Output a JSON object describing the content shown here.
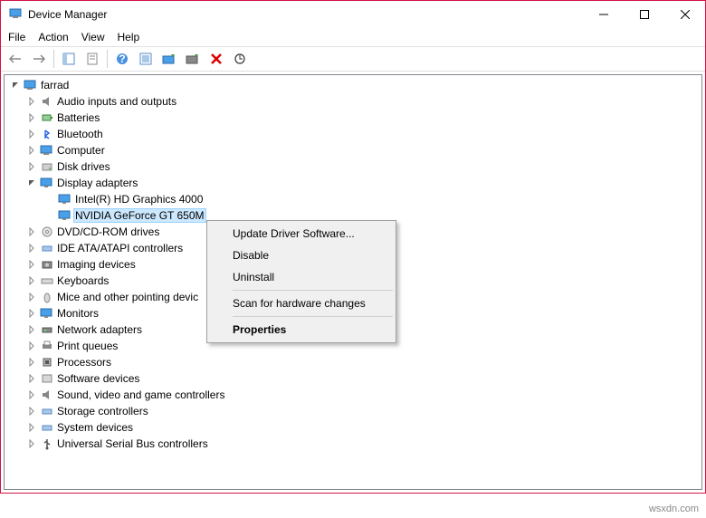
{
  "titlebar": {
    "title": "Device Manager"
  },
  "menubar": {
    "items": [
      "File",
      "Action",
      "View",
      "Help"
    ]
  },
  "tree": {
    "root": "farrad",
    "nodes": [
      {
        "label": "Audio inputs and outputs",
        "expanded": false
      },
      {
        "label": "Batteries",
        "expanded": false
      },
      {
        "label": "Bluetooth",
        "expanded": false
      },
      {
        "label": "Computer",
        "expanded": false
      },
      {
        "label": "Disk drives",
        "expanded": false
      },
      {
        "label": "Display adapters",
        "expanded": true,
        "children": [
          {
            "label": "Intel(R) HD Graphics 4000",
            "selected": false
          },
          {
            "label": "NVIDIA GeForce GT 650M",
            "selected": true
          }
        ]
      },
      {
        "label": "DVD/CD-ROM drives",
        "expanded": false
      },
      {
        "label": "IDE ATA/ATAPI controllers",
        "expanded": false
      },
      {
        "label": "Imaging devices",
        "expanded": false
      },
      {
        "label": "Keyboards",
        "expanded": false
      },
      {
        "label": "Mice and other pointing devic",
        "expanded": false
      },
      {
        "label": "Monitors",
        "expanded": false
      },
      {
        "label": "Network adapters",
        "expanded": false
      },
      {
        "label": "Print queues",
        "expanded": false
      },
      {
        "label": "Processors",
        "expanded": false
      },
      {
        "label": "Software devices",
        "expanded": false
      },
      {
        "label": "Sound, video and game controllers",
        "expanded": false
      },
      {
        "label": "Storage controllers",
        "expanded": false
      },
      {
        "label": "System devices",
        "expanded": false
      },
      {
        "label": "Universal Serial Bus controllers",
        "expanded": false
      }
    ]
  },
  "context_menu": {
    "items": [
      {
        "label": "Update Driver Software...",
        "type": "item"
      },
      {
        "label": "Disable",
        "type": "item"
      },
      {
        "label": "Uninstall",
        "type": "item"
      },
      {
        "type": "sep"
      },
      {
        "label": "Scan for hardware changes",
        "type": "item"
      },
      {
        "type": "sep"
      },
      {
        "label": "Properties",
        "type": "item",
        "bold": true
      }
    ]
  },
  "watermark": "wsxdn.com"
}
